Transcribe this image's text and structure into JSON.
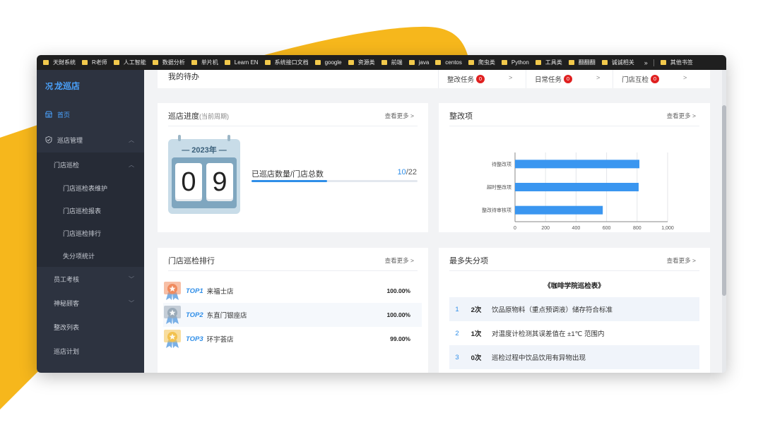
{
  "bookmarks": [
    "天財系统",
    "R老师",
    "人工智能",
    "数据分析",
    "单片机",
    "Learn EN",
    "系统接口文档",
    "google",
    "资源类",
    "前端",
    "java",
    "centos",
    "爬虫类",
    "Python",
    "工具类",
    "翻翻翻",
    "诚诚相关"
  ],
  "bookmarks_more": "»",
  "bookmarks_other": "其他书签",
  "sidebar": {
    "logo": "龙巡店",
    "items": {
      "home": "首页",
      "store_mgmt": "巡店管理",
      "store_patrol": "门店巡检",
      "patrol_table": "门店巡检表维护",
      "patrol_report": "门店巡检报表",
      "patrol_rank": "门店巡检排行",
      "loss_stats": "失分项统计",
      "staff_eval": "员工考核",
      "mystery_guest": "神秘顾客",
      "rectify_list": "整改列表",
      "patrol_plan": "巡店计划"
    }
  },
  "todo": {
    "title": "我的待办",
    "items": [
      {
        "label": "整改任务",
        "count": "0"
      },
      {
        "label": "日常任务",
        "count": "0"
      },
      {
        "label": "门店互检",
        "count": "0"
      }
    ],
    "arrow": ">"
  },
  "progress": {
    "title": "巡店进度",
    "subtitle": "(当前周期)",
    "more": "查看更多 >",
    "year": "— 2023年 —",
    "digit1": "0",
    "digit2": "9",
    "label": "已巡店数量/门店总数",
    "done": "10",
    "slash": "/",
    "total": "22",
    "fill_fraction": 0.4545
  },
  "rectify": {
    "title": "整改项",
    "more": "查看更多 >"
  },
  "chart_data": {
    "type": "bar",
    "orientation": "horizontal",
    "categories": [
      "待整改项",
      "超时整改项",
      "整改待审核项"
    ],
    "values": [
      815,
      810,
      575
    ],
    "xlim": [
      0,
      1000
    ],
    "xticks": [
      "0",
      "200",
      "400",
      "600",
      "800",
      "1,000"
    ],
    "grid": true,
    "bar_color": "#3a96f0"
  },
  "ranking": {
    "title": "门店巡检排行",
    "more": "查看更多 >",
    "rows": [
      {
        "top": "TOP1",
        "name": "来福士店",
        "pct": "100.00%",
        "medal_color": "#f08a5d"
      },
      {
        "top": "TOP2",
        "name": "东直门银座店",
        "pct": "100.00%",
        "medal_color": "#9aaab8"
      },
      {
        "top": "TOP3",
        "name": "环宇荟店",
        "pct": "99.00%",
        "medal_color": "#f2c14e"
      }
    ]
  },
  "loss": {
    "title": "最多失分项",
    "more": "查看更多 >",
    "table_title": "《咖啡学院巡检表》",
    "rows": [
      {
        "idx": "1",
        "count": "2次",
        "text": "饮品原物料（重点预调液）储存符合标准"
      },
      {
        "idx": "2",
        "count": "1次",
        "text": "对温度计检测其误差值在 ±1℃ 范围内"
      },
      {
        "idx": "3",
        "count": "0次",
        "text": "巡检过程中饮品饮用有异物出现"
      }
    ]
  }
}
